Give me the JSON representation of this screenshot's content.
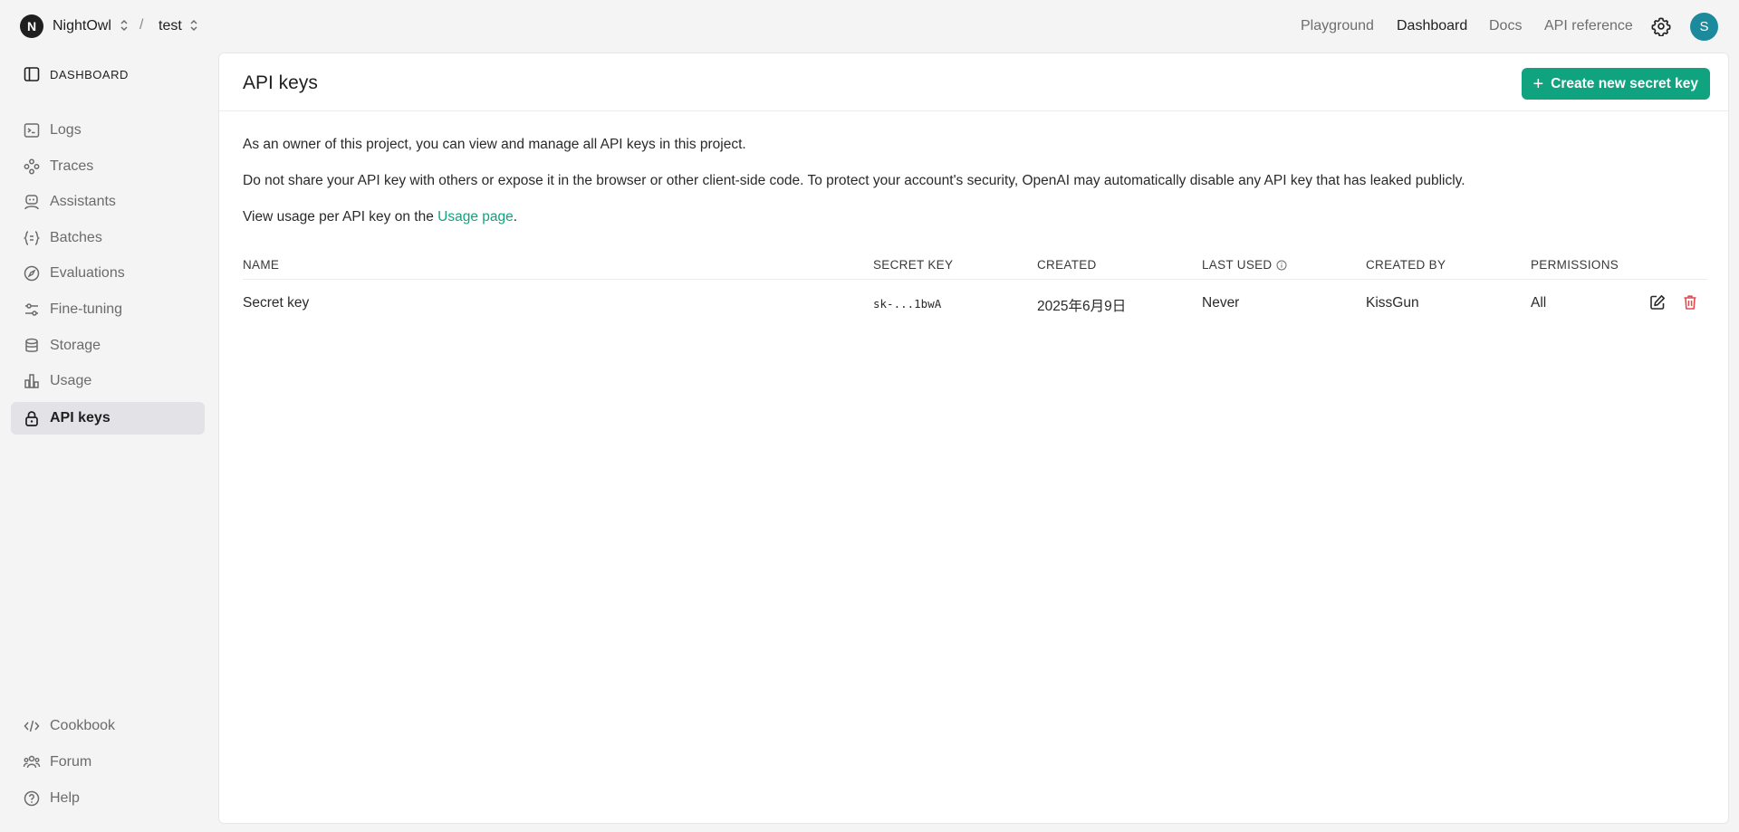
{
  "topbar": {
    "org_initial": "N",
    "org_name": "NightOwl",
    "separator": "/",
    "project_name": "test",
    "nav": [
      {
        "label": "Playground"
      },
      {
        "label": "Dashboard"
      },
      {
        "label": "Docs"
      },
      {
        "label": "API reference"
      }
    ],
    "user_initial": "S",
    "user_avatar_color": "#1b8a9c"
  },
  "sidebar": {
    "header": "DASHBOARD",
    "items": [
      {
        "label": "Logs",
        "icon": "terminal-icon"
      },
      {
        "label": "Traces",
        "icon": "traces-icon"
      },
      {
        "label": "Assistants",
        "icon": "assistant-icon"
      },
      {
        "label": "Batches",
        "icon": "batches-icon"
      },
      {
        "label": "Evaluations",
        "icon": "compass-icon"
      },
      {
        "label": "Fine-tuning",
        "icon": "sliders-icon"
      },
      {
        "label": "Storage",
        "icon": "database-icon"
      },
      {
        "label": "Usage",
        "icon": "bar-chart-icon"
      },
      {
        "label": "API keys",
        "icon": "lock-icon",
        "active": true
      }
    ],
    "footer_items": [
      {
        "label": "Cookbook",
        "icon": "code-icon"
      },
      {
        "label": "Forum",
        "icon": "people-icon"
      },
      {
        "label": "Help",
        "icon": "help-icon"
      }
    ]
  },
  "main": {
    "title": "API keys",
    "create_button_label": "Create new secret key",
    "accent_color": "#10a37f",
    "paragraph1": "As an owner of this project, you can view and manage all API keys in this project.",
    "paragraph2": "Do not share your API key with others or expose it in the browser or other client-side code. To protect your account's security, OpenAI may automatically disable any API key that has leaked publicly.",
    "paragraph3_prefix": "View usage per API key on the ",
    "paragraph3_link": "Usage page",
    "paragraph3_suffix": ".",
    "table": {
      "columns": [
        "NAME",
        "SECRET KEY",
        "CREATED",
        "LAST USED",
        "CREATED BY",
        "PERMISSIONS"
      ],
      "rows": [
        {
          "name": "Secret key",
          "secret_key": "sk-...1bwA",
          "created": "2025年6月9日",
          "last_used": "Never",
          "created_by": "KissGun",
          "permissions": "All"
        }
      ]
    }
  }
}
